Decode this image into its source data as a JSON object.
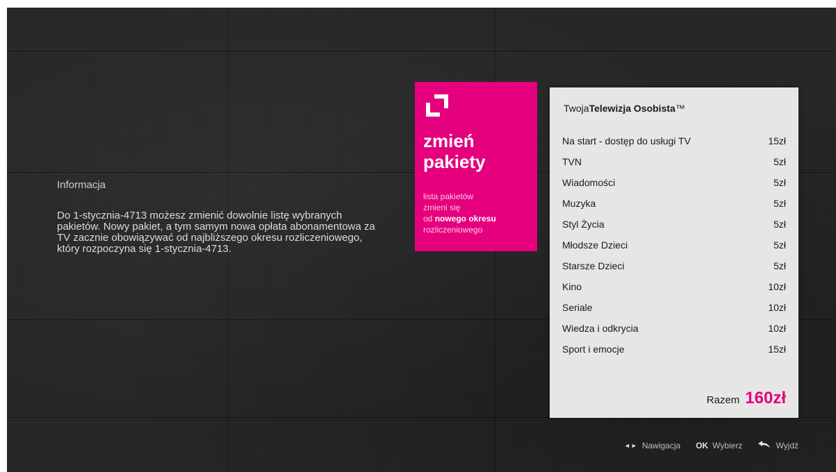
{
  "info": {
    "title": "Informacja",
    "body": "Do 1-stycznia-4713 możesz zmienić dowolnie listę wybranych pakietów. Nowy pakiet, a tym samym nowa opłata abonamentowa za TV zacznie obowiązywać od najbliższego okresu rozliczeniowego, który rozpoczyna się 1-stycznia-4713."
  },
  "tile": {
    "title_line1": "zmień",
    "title_line2": "pakiety",
    "desc_line1": "lista pakietów",
    "desc_line2": "zmieni się",
    "desc_line3_prefix": "od ",
    "desc_line3_bold": "nowego okresu",
    "desc_line4": "rozliczeniowego",
    "icon": "corner-arrows-icon",
    "color": "#e5007d"
  },
  "panel": {
    "header_prefix": "Twoja",
    "header_bold": "Telewizja Osobista",
    "header_mark": "™",
    "rows": [
      {
        "name": "Na start - dostęp do usługi TV",
        "price": "15zł"
      },
      {
        "name": "TVN",
        "price": "5zł"
      },
      {
        "name": "Wiadomości",
        "price": "5zł"
      },
      {
        "name": "Muzyka",
        "price": "5zł"
      },
      {
        "name": "Styl Życia",
        "price": "5zł"
      },
      {
        "name": "Młodsze Dzieci",
        "price": "5zł"
      },
      {
        "name": "Starsze Dzieci",
        "price": "5zł"
      },
      {
        "name": "Kino",
        "price": "10zł"
      },
      {
        "name": "Seriale",
        "price": "10zł"
      },
      {
        "name": "Wiedza i odkrycia",
        "price": "10zł"
      },
      {
        "name": "Sport i emocje",
        "price": "15zł"
      }
    ],
    "total_label": "Razem",
    "total_value": "160zł"
  },
  "hints": {
    "nav_glyph": "◄►",
    "nav_label": "Nawigacja",
    "ok_key": "OK",
    "ok_label": "Wybierz",
    "back_icon": "back-arrow-icon",
    "back_label": "Wyjdź"
  }
}
